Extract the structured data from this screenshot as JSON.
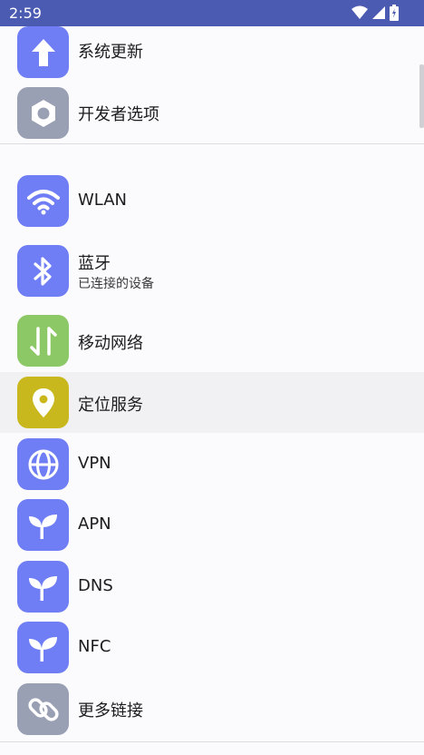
{
  "status": {
    "time": "2:59"
  },
  "items": [
    {
      "label": "系统更新",
      "icon": "arrow-up-icon",
      "color": "#6f7ef5"
    },
    {
      "label": "开发者选项",
      "icon": "hexagon-gear-icon",
      "color": "#9aa0b4"
    },
    {
      "label": "WLAN",
      "icon": "wifi-icon",
      "color": "#6f7ef5"
    },
    {
      "label": "蓝牙",
      "sublabel": "已连接的设备",
      "icon": "bluetooth-icon",
      "color": "#6f7ef5"
    },
    {
      "label": "移动网络",
      "icon": "mobile-data-icon",
      "color": "#8cc866"
    },
    {
      "label": "定位服务",
      "icon": "location-pin-icon",
      "color": "#c8b81e"
    },
    {
      "label": "VPN",
      "icon": "globe-icon",
      "color": "#6f7ef5"
    },
    {
      "label": "APN",
      "icon": "sprout-icon",
      "color": "#6f7ef5"
    },
    {
      "label": "DNS",
      "icon": "sprout-icon",
      "color": "#6f7ef5"
    },
    {
      "label": "NFC",
      "icon": "sprout-icon",
      "color": "#6f7ef5"
    },
    {
      "label": "更多链接",
      "icon": "link-icon",
      "color": "#9aa0b4"
    }
  ]
}
